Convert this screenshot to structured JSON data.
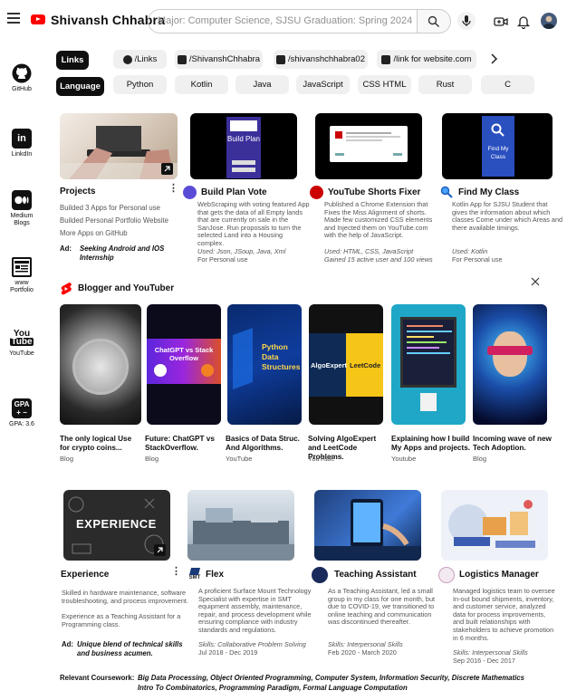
{
  "header": {
    "brand": "Shivansh Chhabra",
    "search_text": "Major: Computer Science, SJSU     Graduation: Spring 2024"
  },
  "sidebar": [
    {
      "label": "GitHub"
    },
    {
      "label": "LinkdIn"
    },
    {
      "label": "Medium Blogs"
    },
    {
      "label": "www Portfolio"
    },
    {
      "label": "YouTube"
    },
    {
      "label": "GPA: 3.6",
      "badge": "GPA"
    }
  ],
  "chips_links": {
    "active": "Links",
    "items": [
      "/Links",
      "/ShivanshChhabra",
      "/shivanshchhabra02",
      "/link for website.com"
    ]
  },
  "chips_lang": {
    "active": "Language",
    "items": [
      "Python",
      "Kotlin",
      "Java",
      "JavaScript",
      "CSS  HTML",
      "Rust",
      "C"
    ]
  },
  "projects": {
    "title": "Projects",
    "lines": [
      "Builded 3 Apps for Personal use",
      "Builded Personal Portfolio Website",
      "More Apps on GitHub"
    ],
    "ad_label": "Ad:",
    "ad_text": "Seeking Android and IOS Internship"
  },
  "project_cards": [
    {
      "title": "Build Plan Vote",
      "thumb_text": "Build Plan",
      "desc": "WebScraping with voting featured App that gets the data of all Empty lands that are currently on sale in the SanJose. Run proposals to turn the selected Land into a Housing complex.",
      "used": "Used: Json, JSoup, Java, Xml",
      "note": "For Personal use"
    },
    {
      "title": "YouTube Shorts Fixer",
      "desc": "Published a Chrome Extension that Fixes the Miss Alignment of shorts. Made few customized CSS elements and Injected them on YouTube.com with the help of JavaScript.",
      "used": "Used: HTML, CSS, JavaScript",
      "note": "Gained 15 active user and 100 views"
    },
    {
      "title": "Find My Class",
      "thumb_text": "Find My Class",
      "desc": "Kotlin App for SJSU Student that gives the information about which classes Come under which Areas and there available timings.",
      "used": "Used: Kotlin",
      "note": "For Personal use"
    }
  ],
  "shorts": {
    "title": "Blogger and YouTuber",
    "items": [
      {
        "title": "The only logical Use for crypto coins...",
        "sub": "Blog"
      },
      {
        "title": "Future: ChatGPT vs StackOverflow.",
        "sub": "Blog",
        "thumb_text": "ChatGPT vs Stack Overflow"
      },
      {
        "title": "Basics of Data Struc. And Algorithms.",
        "sub": "YouTube",
        "thumb_text": "Python Data Structures"
      },
      {
        "title": "Solving AlgoExpert and LeetCode Problems.",
        "sub": "YouTube",
        "thumb_text_a": "AlgoExpert",
        "thumb_text_b": "LeetCode"
      },
      {
        "title": "Explaining how I build My Apps and projects.",
        "sub": "Youtube"
      },
      {
        "title": "Incoming wave of new Tech Adoption.",
        "sub": "Blog"
      }
    ]
  },
  "experience": {
    "title": "Experience",
    "thumb_text": "EXPERIENCE",
    "lines": [
      "Skilled in hardware maintenance, software troubleshooting, and process improvement.",
      "Experience as a Teaching Assistant for a Programming class."
    ],
    "ad_label": "Ad:",
    "ad_text": "Unique blend of technical skills and business acumen."
  },
  "exp_cards": [
    {
      "title": "Flex",
      "logo": "SMT",
      "desc": "A proficient Surface Mount Technology Specialist with expertise in SMT equipment assembly, maintenance, repair, and process development while ensuring compliance with industry standards and regulations.",
      "skills": "Skills: Collaborative Problem Solving",
      "dates": "Jul 2018 - Dec 2019"
    },
    {
      "title": "Teaching Assistant",
      "desc": "As a Teaching Assistant, led a small group in my class for one month, but due to COVID-19, we transitioned to online teaching and communication was discontinued thereafter.",
      "skills": "Skills: Interpersonal Skills",
      "dates": "Feb 2020 - March 2020"
    },
    {
      "title": "Logistics Manager",
      "desc": "Managed logistics team to oversee In-out bound shipments, inventory, and customer service, analyzed data for process improvements, and built relationships with stakeholders to achieve promotion in 6 months.",
      "skills": "Skills: Interpersonal Skills",
      "dates": "Sep 2016 - Dec 2017"
    }
  ],
  "coursework": {
    "label": "Relevant Coursework:",
    "line1": "Big Data Processing, Object Oriented Programming, Computer System, Information Security, Discrete Mathematics",
    "line2": "Intro To Combinatorics, Programming Paradigm, Formal Language Computation"
  },
  "colors": {
    "youtube_red": "#ff0000",
    "chip_bg": "#f0f0f0",
    "text": "#0f0f0f",
    "muted": "#555555"
  }
}
